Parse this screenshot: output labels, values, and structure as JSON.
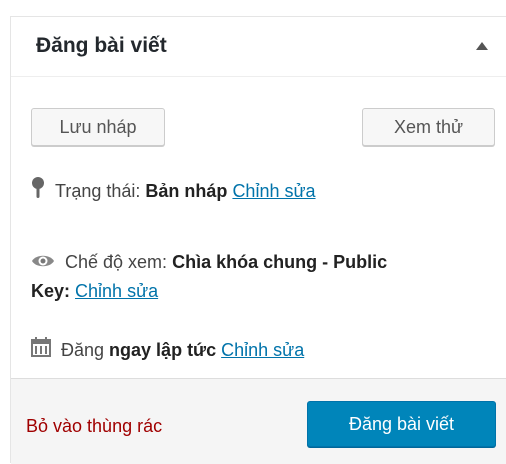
{
  "box": {
    "title": "Đăng bài viết",
    "toggle_icon": "triangle-up-icon"
  },
  "actions": {
    "save_draft_label": "Lưu nháp",
    "preview_label": "Xem thử"
  },
  "status": {
    "icon": "pin-icon",
    "label": "Trạng thái:",
    "value": "Bản nháp",
    "edit_link": "Chỉnh sửa"
  },
  "visibility": {
    "icon": "eye-icon",
    "label": "Chế độ xem:",
    "value_line1": "Chìa khóa chung - Public",
    "value_line2": "Key:",
    "edit_link": "Chỉnh sửa"
  },
  "schedule": {
    "icon": "calendar-icon",
    "label": "Đăng",
    "value": "ngay lập tức",
    "edit_link": "Chỉnh sửa"
  },
  "footer": {
    "trash_label": "Bỏ vào thùng rác",
    "publish_label": "Đăng bài viết"
  },
  "colors": {
    "link": "#0073aa",
    "trash": "#a00000",
    "primary_button": "#0085ba"
  }
}
